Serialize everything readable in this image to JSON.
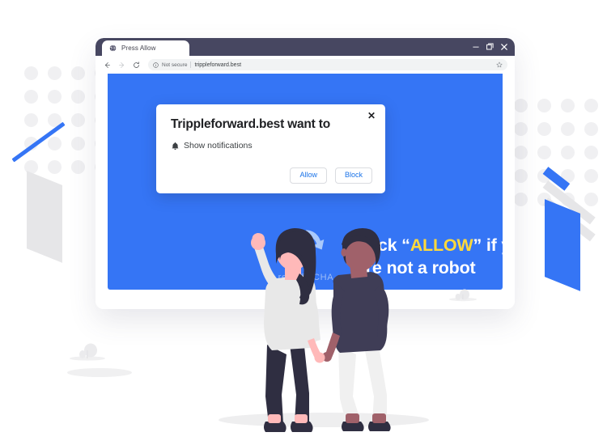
{
  "browser": {
    "tab": {
      "title": "Press Allow",
      "favicon_icon": "globe-icon"
    },
    "window_controls": {
      "minimize_icon": "minimize-icon",
      "minimize_glyph": "−",
      "maximize_icon": "restore-icon",
      "close_icon": "close-icon",
      "close_glyph": "✕"
    },
    "toolbar": {
      "back_icon": "back-arrow-icon",
      "forward_icon": "forward-arrow-icon",
      "reload_icon": "reload-icon",
      "info_icon": "info-circle-icon",
      "security_label": "Not secure",
      "url": "trippleforward.best",
      "bookmark_icon": "star-icon"
    }
  },
  "notification_dialog": {
    "title": "Trippleforward.best want to",
    "permission_icon": "bell-icon",
    "permission_label": "Show notifications",
    "allow_label": "Allow",
    "block_label": "Block",
    "close_icon": "close-icon",
    "close_glyph": "✕"
  },
  "page_content": {
    "recaptcha": {
      "logo_icon": "recaptcha-circular-arrows-icon",
      "label": "reCAPTCHA"
    },
    "headline": {
      "line1_pre": "Click “",
      "accent": "ALLOW",
      "line1_post": "” if you",
      "line2": "are not a robot"
    }
  },
  "illustration": {
    "figure_left": "woman-raising-arm",
    "figure_right": "man-walking",
    "ground_shadow": "ground-ellipse"
  },
  "colors": {
    "brand_blue": "#3575f5",
    "titlebar_navy": "#474761",
    "accent_yellow": "#ffd93b",
    "link_blue": "#1a73e8",
    "recaptcha_light_blue": "#9dbdf7",
    "decor_gray": "#e6e6e8"
  }
}
